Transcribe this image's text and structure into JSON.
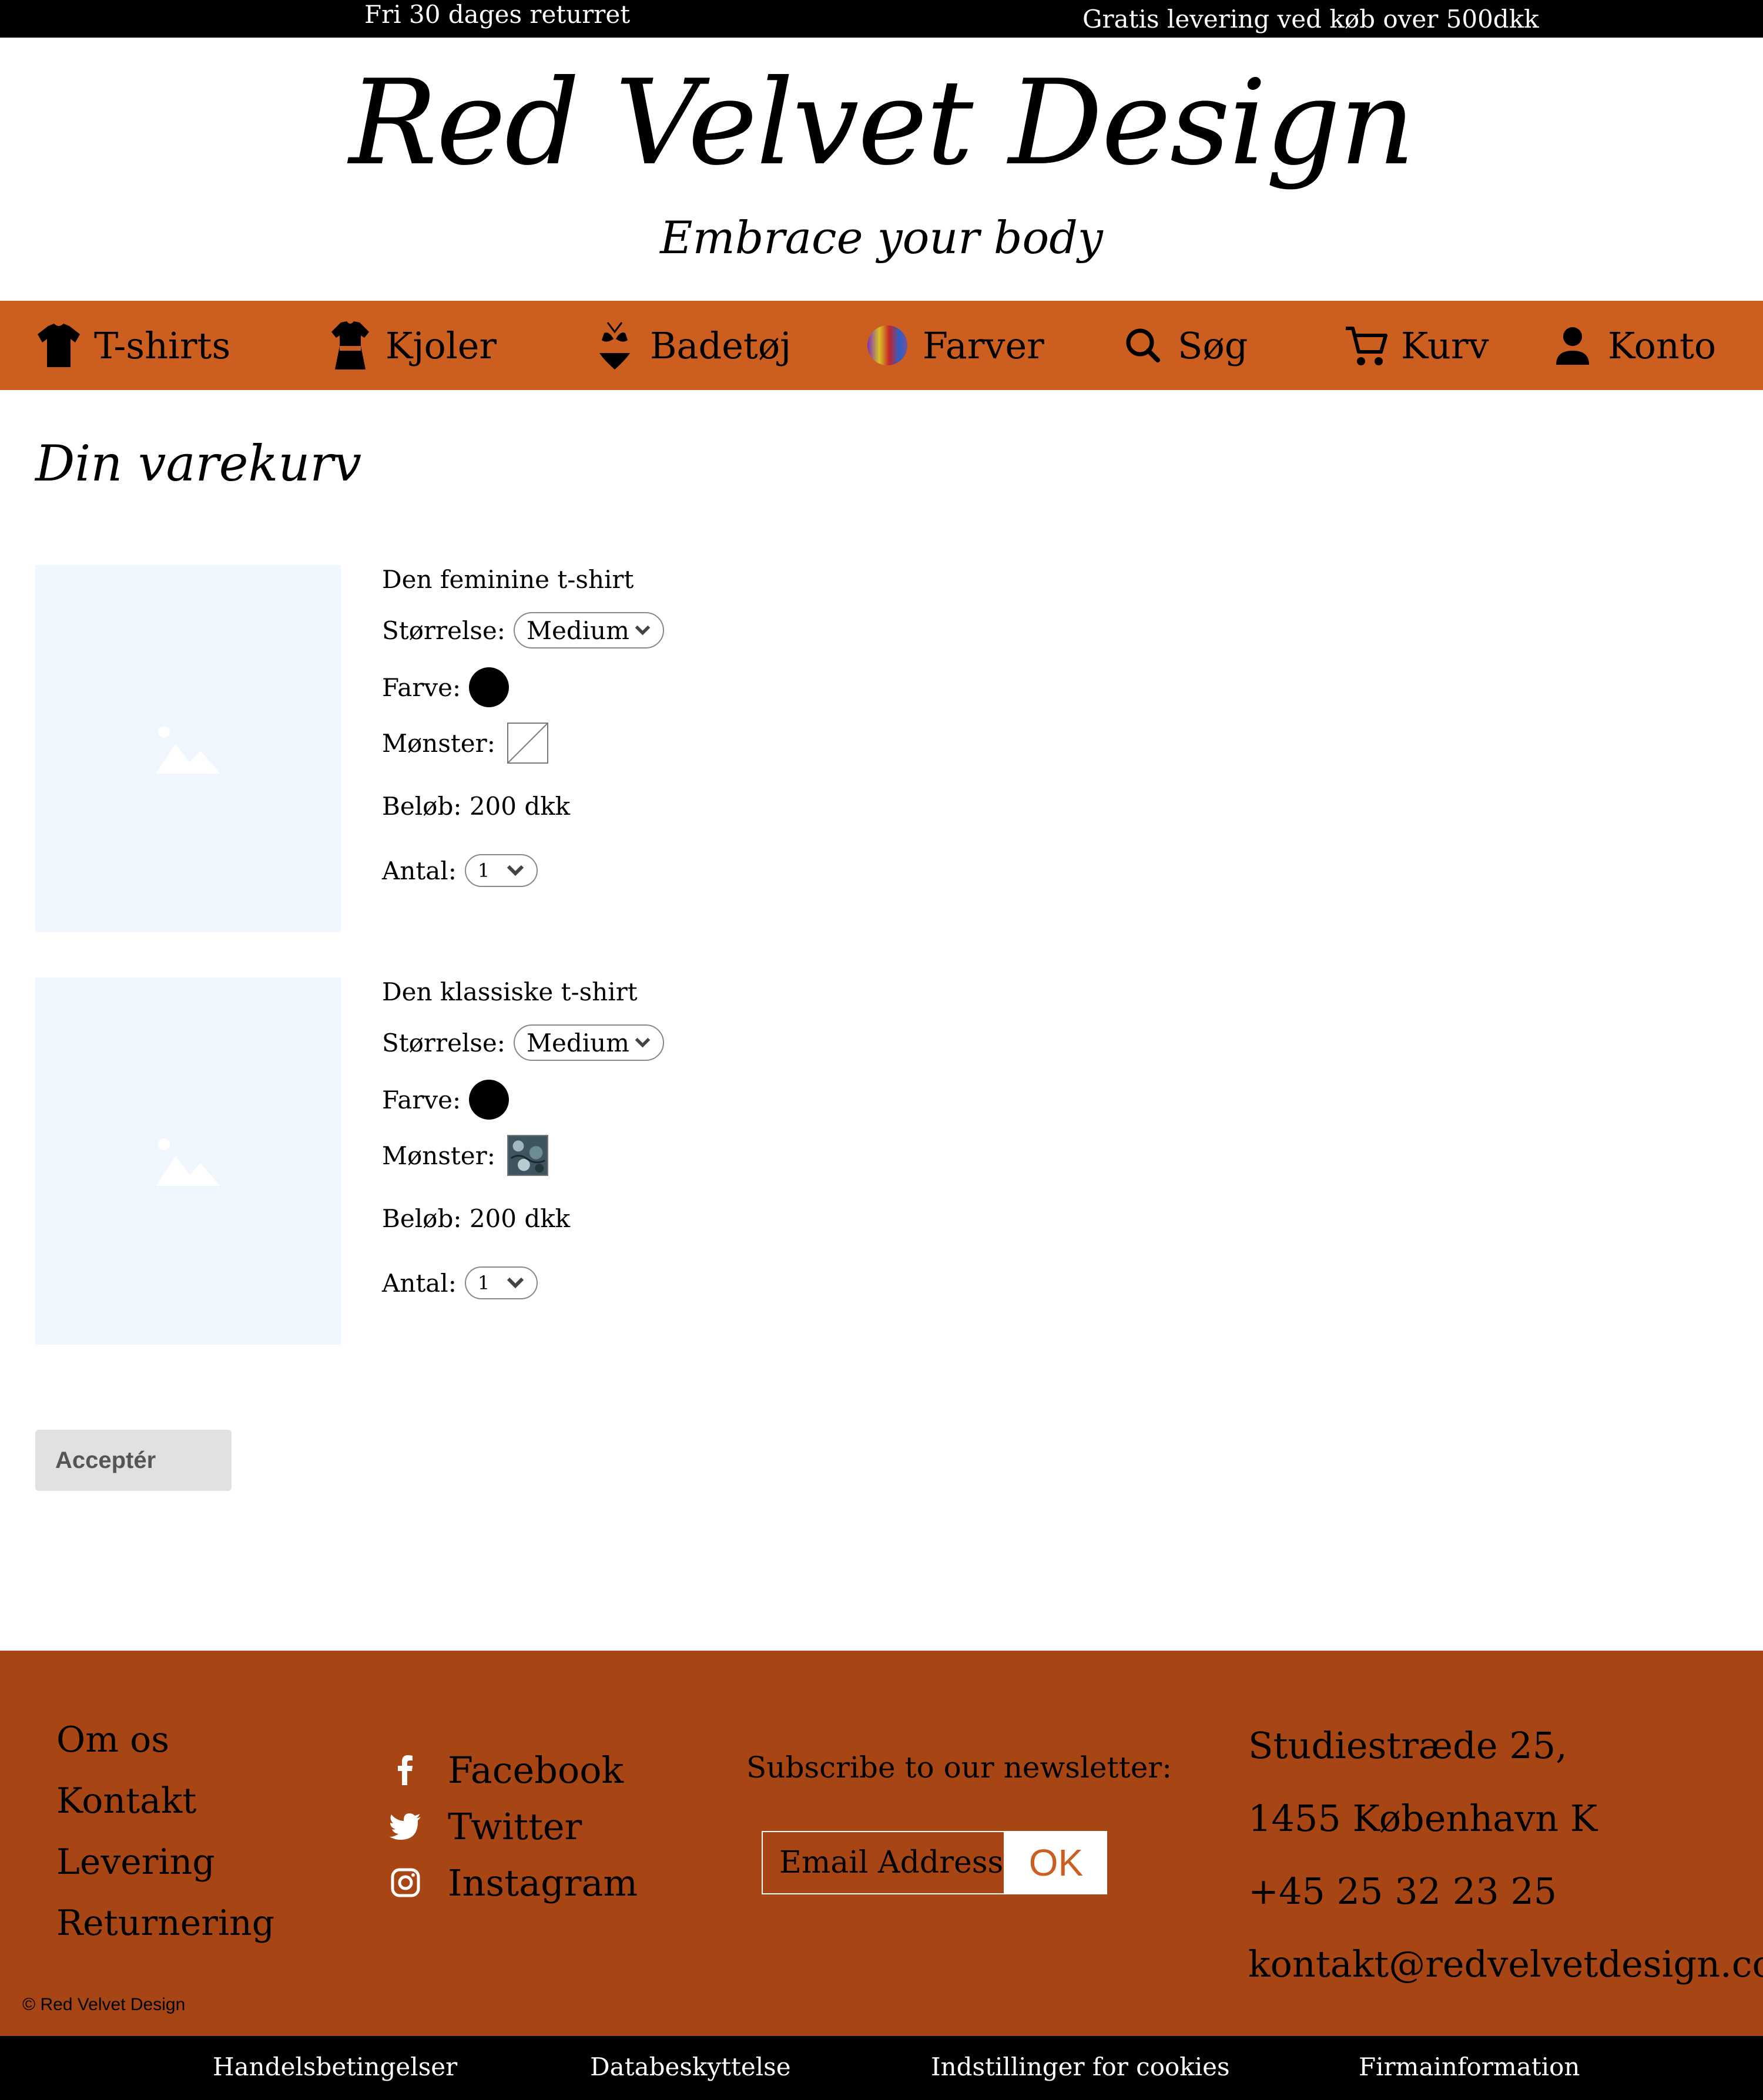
{
  "topbar": {
    "left": "Fri 30 dages returret",
    "right": "Gratis levering ved køb over 500dkk"
  },
  "header": {
    "logo": "Red Velvet Design",
    "tagline": "Embrace your body"
  },
  "nav": {
    "items": [
      {
        "label": "T-shirts",
        "icon": "tshirt-icon"
      },
      {
        "label": "Kjoler",
        "icon": "dress-icon"
      },
      {
        "label": "Badetøj",
        "icon": "bikini-icon"
      },
      {
        "label": "Farver",
        "icon": "color-swatch-icon"
      },
      {
        "label": "Søg",
        "icon": "search-icon"
      },
      {
        "label": "Kurv",
        "icon": "cart-icon"
      },
      {
        "label": "Konto",
        "icon": "account-icon"
      }
    ]
  },
  "cart": {
    "title": "Din varekurv",
    "labels": {
      "size": "Størrelse:",
      "color": "Farve:",
      "pattern": "Mønster:",
      "quantity": "Antal:"
    },
    "items": [
      {
        "name": "Den feminine t-shirt",
        "size": "Medium",
        "color": "#000000",
        "pattern": "none",
        "price": "Beløb: 200 dkk",
        "quantity": "1"
      },
      {
        "name": "Den klassiske t-shirt",
        "size": "Medium",
        "color": "#000000",
        "pattern": "floral",
        "price": "Beløb: 200 dkk",
        "quantity": "1"
      }
    ],
    "accept_label": "Acceptér"
  },
  "footer": {
    "links": [
      "Om os",
      "Kontakt",
      "Levering",
      "Returnering"
    ],
    "social": [
      {
        "label": "Facebook",
        "icon": "facebook-icon"
      },
      {
        "label": "Twitter",
        "icon": "twitter-icon"
      },
      {
        "label": "Instagram",
        "icon": "instagram-icon"
      }
    ],
    "newsletter_label": "Subscribe to our newsletter:",
    "email_placeholder": "Email Address",
    "ok_label": "OK",
    "address": [
      "Studiestræde 25,",
      "1455 København K",
      "+45 25 32 23 25",
      "kontakt@redvelvetdesign.com"
    ],
    "copyright": "© Red Velvet Design"
  },
  "bottombar": {
    "links": [
      "Handelsbetingelser",
      "Databeskyttelse",
      "Indstillinger for cookies",
      "Firmainformation"
    ]
  },
  "colors": {
    "nav_bg": "#cc5e20",
    "footer_bg": "#a84515",
    "placeholder_bg": "#eff6fd"
  }
}
